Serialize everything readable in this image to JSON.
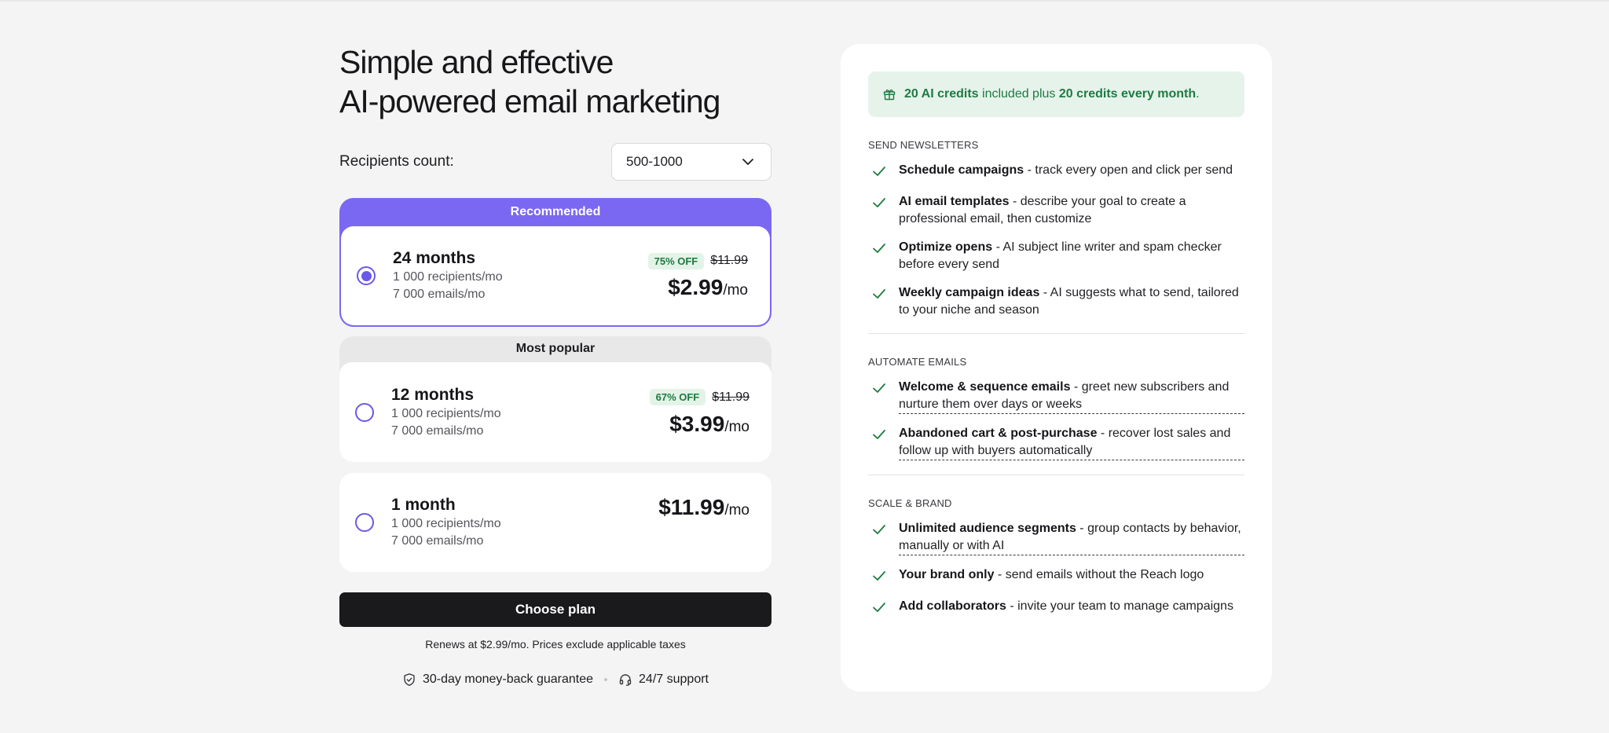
{
  "heading": {
    "line1": "Simple and effective",
    "line2": "AI-powered email marketing"
  },
  "recipients": {
    "label": "Recipients count:",
    "selected": "500-1000"
  },
  "plans": [
    {
      "banner": "Recommended",
      "name": "24 months",
      "recipients": "1 000 recipients/mo",
      "emails": "7 000 emails/mo",
      "discount": "75% OFF",
      "old_price": "$11.99",
      "price": "$2.99",
      "per": "/mo",
      "selected": true
    },
    {
      "banner": "Most popular",
      "name": "12 months",
      "recipients": "1 000 recipients/mo",
      "emails": "7 000 emails/mo",
      "discount": "67% OFF",
      "old_price": "$11.99",
      "price": "$3.99",
      "per": "/mo",
      "selected": false
    },
    {
      "name": "1 month",
      "recipients": "1 000 recipients/mo",
      "emails": "7 000 emails/mo",
      "price": "$11.99",
      "per": "/mo",
      "selected": false
    }
  ],
  "cta": {
    "label": "Choose plan",
    "renews_note": "Renews at $2.99/mo. Prices exclude applicable taxes"
  },
  "guarantees": {
    "money_back": "30-day money-back guarantee",
    "support": "24/7 support"
  },
  "credits_banner": {
    "part1": "20 AI credits",
    "part2": " included plus ",
    "part3": "20 credits every month",
    "part4": "."
  },
  "sections": [
    {
      "title": "SEND NEWSLETTERS",
      "features": [
        {
          "bold": "Schedule campaigns",
          "text": " - track every open and click per send"
        },
        {
          "bold": "AI email templates",
          "text": " - describe your goal to create a professional email, then customize"
        },
        {
          "bold": "Optimize opens",
          "text": " - AI subject line writer and spam checker before every send"
        },
        {
          "bold": "Weekly campaign ideas",
          "text": " - AI suggests what to send, tailored to your niche and season"
        }
      ]
    },
    {
      "title": "AUTOMATE EMAILS",
      "features": [
        {
          "bold": "Welcome & sequence emails",
          "text": " - greet new subscribers and nurture them over days or weeks"
        },
        {
          "bold": "Abandoned cart & post-purchase",
          "text": " - recover lost sales and follow up with buyers automatically"
        }
      ]
    },
    {
      "title": "SCALE & BRAND",
      "features": [
        {
          "bold": "Unlimited audience segments",
          "text": " - group contacts by behavior, manually or with AI"
        },
        {
          "bold": "Your brand only",
          "text": " - send emails without the Reach logo"
        },
        {
          "bold": "Add collaborators",
          "text": " - invite your team to manage campaigns"
        }
      ]
    }
  ],
  "colors": {
    "accent": "#7a68f3",
    "radio": "#6a58e8",
    "success": "#1c7a3f",
    "cta": "#1a1a1c"
  },
  "icons": {
    "check": "check-icon",
    "gift": "gift-icon",
    "shield": "shield-check-icon",
    "headset": "headset-icon",
    "chevron": "chevron-down-icon"
  }
}
